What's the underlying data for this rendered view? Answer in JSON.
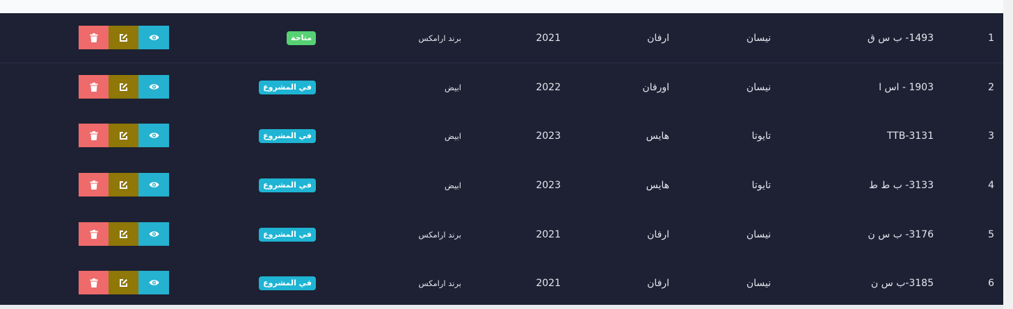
{
  "colors": {
    "table_bg": "#1d2133",
    "available_badge": "#56d173",
    "in_project_badge": "#1fb4d3",
    "view_button": "#25b1d0",
    "edit_button": "#8f7708",
    "delete_button": "#ef6a6a"
  },
  "icons": {
    "view": "eye-icon",
    "edit": "edit-icon",
    "delete": "trash-icon"
  },
  "rows": [
    {
      "index": "1",
      "plate": "1493- ب س ق",
      "brand": "نيسان",
      "model": "ارفان",
      "year": "2021",
      "color": "برند ارامكس",
      "status": "متاحة",
      "status_type": "available"
    },
    {
      "index": "2",
      "plate": "1903 - اس ا",
      "brand": "نيسان",
      "model": "اورفان",
      "year": "2022",
      "color": "ابيض",
      "status": "في المشروع",
      "status_type": "in_project"
    },
    {
      "index": "3",
      "plate": "TTB-3131",
      "brand": "تايوتا",
      "model": "هايس",
      "year": "2023",
      "color": "ابيض",
      "status": "في المشروع",
      "status_type": "in_project"
    },
    {
      "index": "4",
      "plate": "3133- ب ط ط",
      "brand": "تايوتا",
      "model": "هايس",
      "year": "2023",
      "color": "ابيض",
      "status": "في المشروع",
      "status_type": "in_project"
    },
    {
      "index": "5",
      "plate": "3176- ب س ن",
      "brand": "نيسان",
      "model": "ارفان",
      "year": "2021",
      "color": "برند ارامكس",
      "status": "في المشروع",
      "status_type": "in_project"
    },
    {
      "index": "6",
      "plate": "3185-ب س ن",
      "brand": "نيسان",
      "model": "ارفان",
      "year": "2021",
      "color": "برند ارامكس",
      "status": "في المشروع",
      "status_type": "in_project"
    }
  ]
}
